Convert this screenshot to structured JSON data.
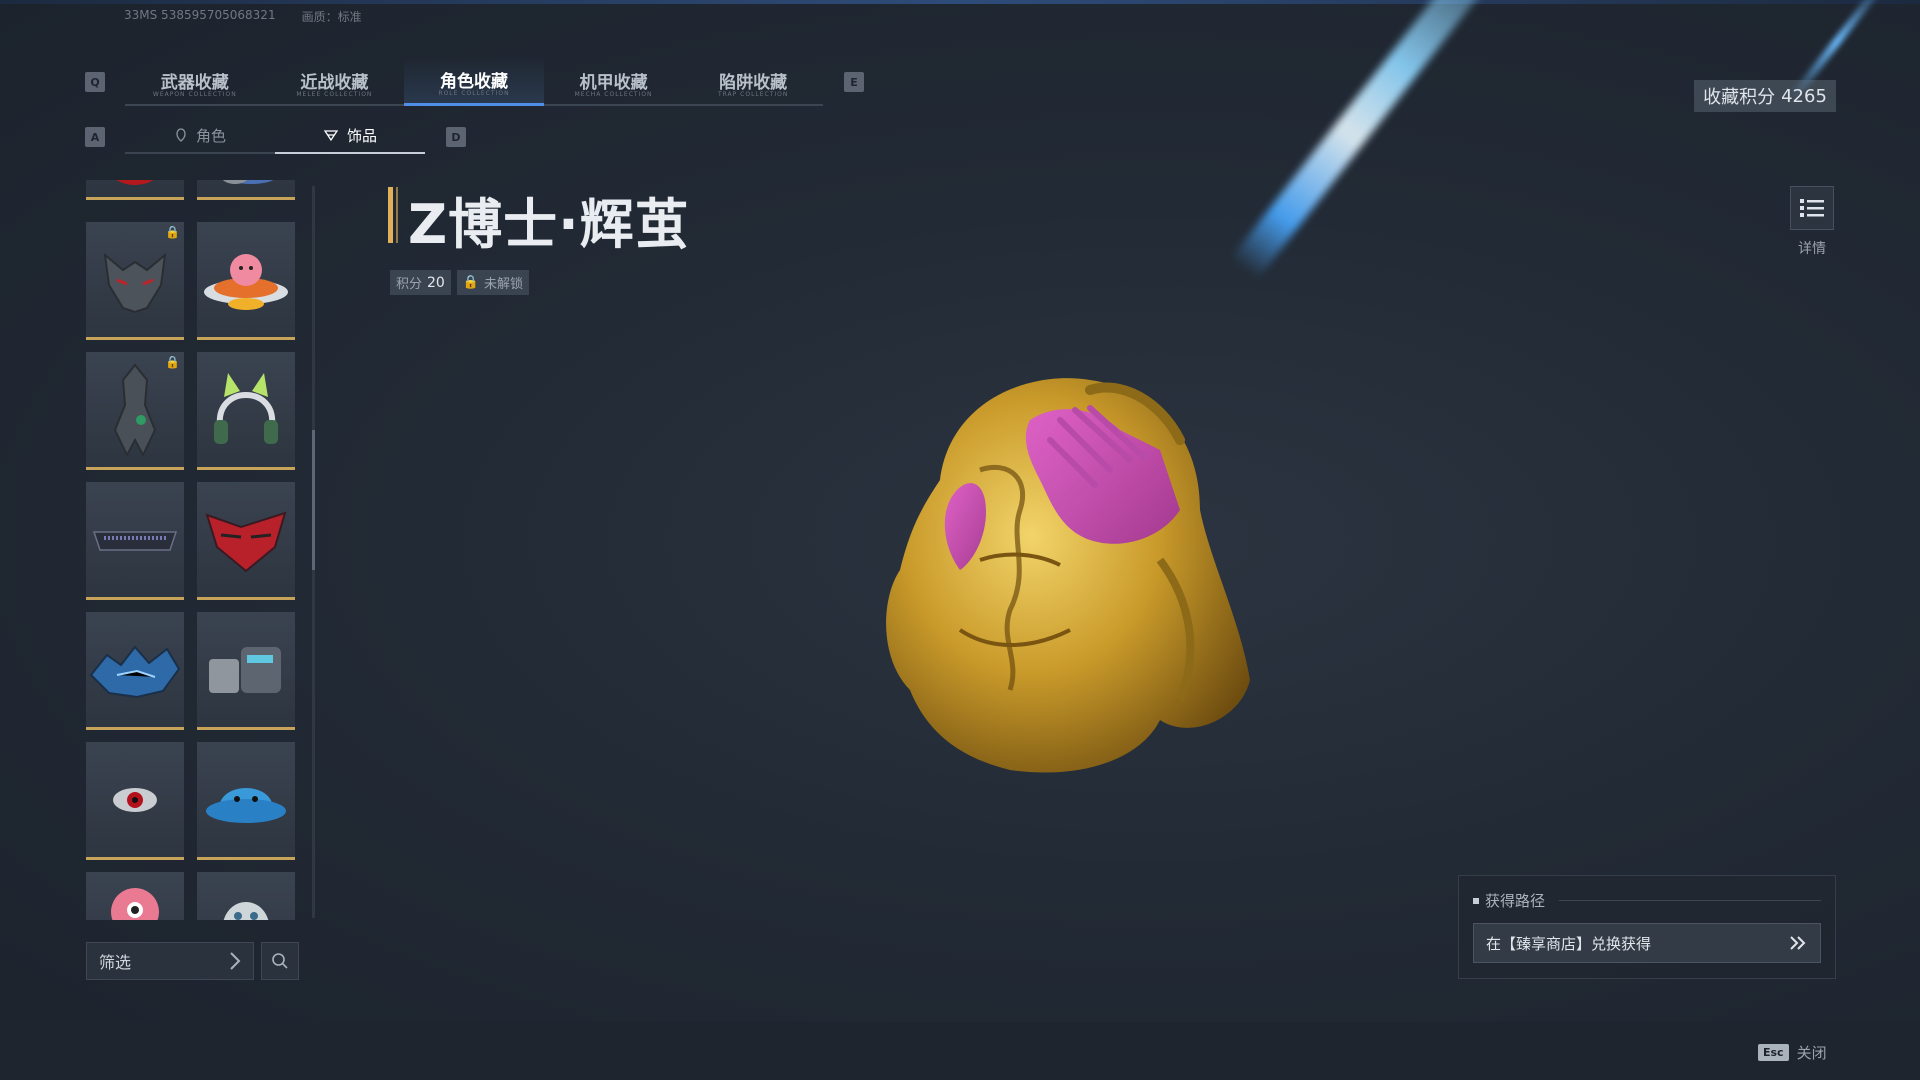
{
  "meta": {
    "id_text": "33MS  538595705068321",
    "quality_text": "画质：标准"
  },
  "keys": {
    "left_tab": "Q",
    "right_tab": "E",
    "left_sub": "A",
    "right_sub": "D"
  },
  "tabs": [
    {
      "label": "武器收藏",
      "sub": "WEAPON COLLECTION"
    },
    {
      "label": "近战收藏",
      "sub": "MELEE COLLECTION"
    },
    {
      "label": "角色收藏",
      "sub": "ROLE COLLECTION"
    },
    {
      "label": "机甲收藏",
      "sub": "MECHA COLLECTION"
    },
    {
      "label": "陷阱收藏",
      "sub": "TRAP COLLECTION"
    }
  ],
  "active_tab_index": 2,
  "subtabs": [
    {
      "label": "角色",
      "icon": "character-icon"
    },
    {
      "label": "饰品",
      "icon": "accessory-icon"
    }
  ],
  "collection_score": {
    "label": "收藏积分",
    "value": "4265"
  },
  "item": {
    "title": "Z博士·辉茧",
    "points_label": "积分",
    "points_value": "20",
    "lock_status": "未解锁"
  },
  "detail": {
    "label": "详情",
    "icon": "list-icon"
  },
  "filter": {
    "label": "筛选",
    "icon": "chevron-right-icon",
    "search_icon": "search-icon"
  },
  "source": {
    "header": "获得路径",
    "text": "在【臻享商店】兑换获得",
    "icon": "double-chevron-right-icon"
  },
  "close": {
    "key": "Esc",
    "label": "关闭"
  },
  "grid_items": [
    {
      "name": "red-accessory",
      "locked": false,
      "partial": "top"
    },
    {
      "name": "blue-accessory",
      "locked": false,
      "partial": "top"
    },
    {
      "name": "wolf-mask",
      "locked": true
    },
    {
      "name": "pig-ufo",
      "locked": false
    },
    {
      "name": "dark-armor-figure",
      "locked": true
    },
    {
      "name": "cat-ear-headphones",
      "locked": false
    },
    {
      "name": "visor-glasses",
      "locked": false
    },
    {
      "name": "red-demon-mask",
      "locked": false
    },
    {
      "name": "ice-dragon-helm",
      "locked": false
    },
    {
      "name": "mech-gauntlet",
      "locked": false
    },
    {
      "name": "eye-ring",
      "locked": false
    },
    {
      "name": "blue-bucket-hat",
      "locked": false
    },
    {
      "name": "pink-creature",
      "locked": false,
      "partial": "bottom"
    },
    {
      "name": "robot-dome",
      "locked": false,
      "partial": "bottom"
    }
  ],
  "colors": {
    "accent_gold": "#e1b15a",
    "tab_active": "#4f8fe8",
    "beam": "#8fd6ff"
  }
}
